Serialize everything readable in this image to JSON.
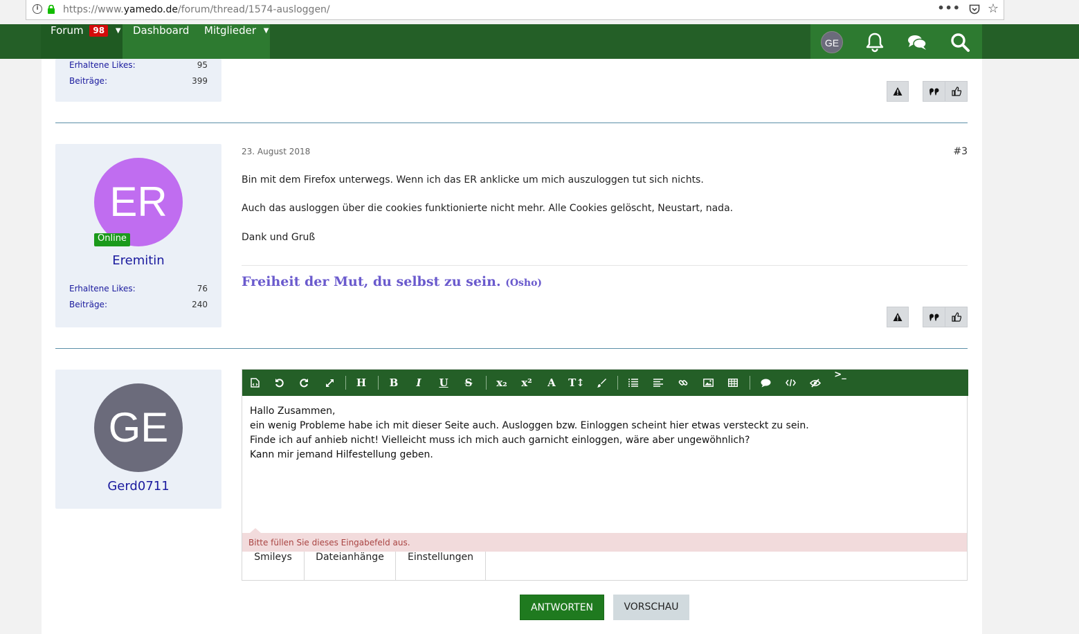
{
  "browser": {
    "url_prefix": "https://www.",
    "url_domain": "yamedo.de",
    "url_path": "/forum/thread/1574-ausloggen/",
    "more_label": "•••"
  },
  "nav": {
    "forum_label": "Forum",
    "forum_badge": "98",
    "dashboard_label": "Dashboard",
    "members_label": "Mitglieder",
    "user_initials": "GE"
  },
  "prev_post": {
    "likes_label": "Erhaltene Likes:",
    "likes_value": "95",
    "posts_label": "Beiträge:",
    "posts_value": "399"
  },
  "post3": {
    "avatar_initials": "ER",
    "avatar_color": "#c06df0",
    "online_label": "Online",
    "username": "Eremitin",
    "likes_label": "Erhaltene Likes:",
    "likes_value": "76",
    "posts_label": "Beiträge:",
    "posts_value": "240",
    "date": "23. August 2018",
    "number": "#3",
    "lines": [
      "Bin mit dem Firefox unterwegs. Wenn ich das ER anklicke um mich auszuloggen tut sich nichts.",
      "Auch das ausloggen über die cookies funktionierte nicht mehr. Alle Cookies gelöscht, Neustart, nada.",
      "Dank und Gruß"
    ],
    "signature_quote": "Freiheit der Mut, du selbst zu sein.",
    "signature_author": "(Osho)"
  },
  "reply": {
    "avatar_initials": "GE",
    "avatar_color": "#6b6b7b",
    "username": "Gerd0711",
    "toolbar": {
      "heading": "H",
      "bold": "B",
      "italic": "I",
      "underline": "U",
      "strike": "S",
      "subscript": "x₂",
      "superscript": "x²",
      "font_color": "A",
      "font_size": "T↕",
      "code_prompt": ">_"
    },
    "text_lines": [
      "Hallo Zusammen,",
      "ein wenig Probleme habe ich mit dieser Seite auch. Ausloggen bzw. Einloggen scheint hier etwas versteckt zu sein.",
      "Finde ich auf anhieb nicht! Vielleicht muss ich mich auch garnicht einloggen, wäre aber ungewöhnlich?",
      "Kann mir jemand Hilfestellung geben."
    ],
    "error_text": "Bitte füllen Sie dieses Eingabefeld aus.",
    "tabs": [
      "Smileys",
      "Dateianhänge",
      "Einstellungen"
    ],
    "submit_label": "ANTWORTEN",
    "preview_label": "VORSCHAU"
  },
  "colors": {
    "nav_bg": "#245f27",
    "accent_green": "#1f7a1f",
    "username_blue": "#1a1a9e",
    "signature_purple": "#6a5acd",
    "badge_red": "#d30b0b"
  }
}
